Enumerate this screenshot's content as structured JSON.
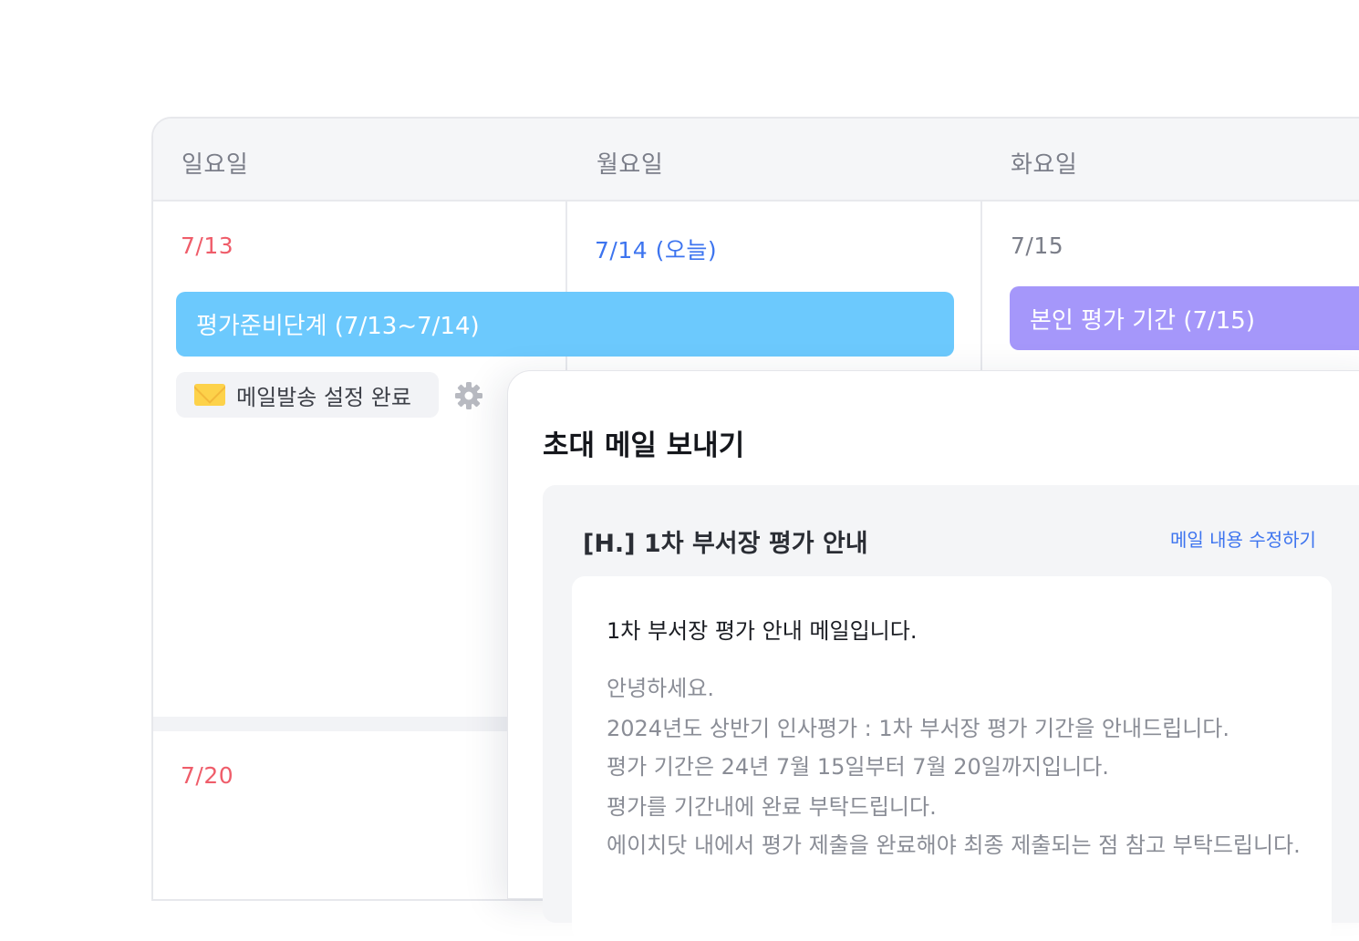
{
  "calendar": {
    "days": [
      "일요일",
      "월요일",
      "화요일"
    ],
    "dates": {
      "sun": "7/13",
      "mon": "7/14 (오늘)",
      "tue": "7/15",
      "next_sun": "7/20"
    },
    "events": {
      "prep": "평가준비단계 (7/13~7/14)",
      "self": "본인 평가 기간 (7/15)"
    },
    "chip": {
      "label": "메일발송 설정 완료",
      "icon": "envelope-icon"
    },
    "colors": {
      "sunday": "#ef5d6a",
      "today": "#3d74ef",
      "prep_event": "#6cc9fd",
      "self_event": "#a597fa"
    }
  },
  "modal": {
    "title": "초대 메일 보내기",
    "subject": "[H.] 1차 부서장 평가 안내",
    "edit_link": "메일 내용 수정하기",
    "body": {
      "heading": "1차 부서장 평가 안내 메일입니다.",
      "lines": [
        "안녕하세요.",
        "2024년도 상반기 인사평가 : 1차 부서장 평가 기간을 안내드립니다.",
        "평가 기간은 24년 7월 15일부터 7월 20일까지입니다.",
        "평가를 기간내에 완료 부탁드립니다.",
        "에이치닷 내에서 평가 제출을 완료해야 최종 제출되는 점 참고 부탁드립니다."
      ]
    }
  }
}
